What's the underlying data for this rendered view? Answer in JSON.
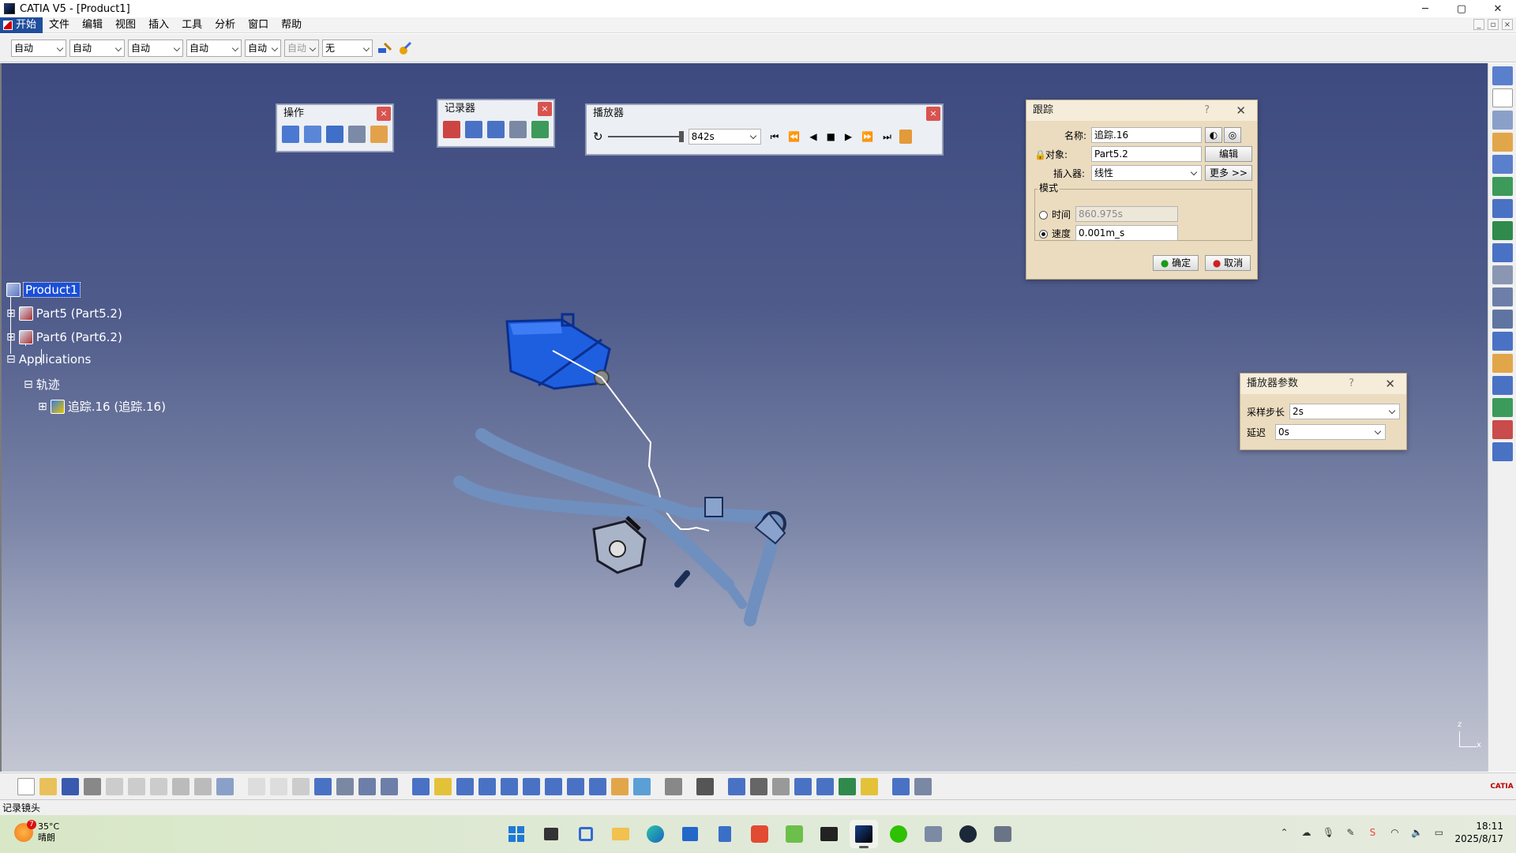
{
  "window": {
    "title": "CATIA V5 - [Product1]",
    "minimize": "─",
    "maximize": "▢",
    "close": "✕"
  },
  "menu": {
    "items": [
      "开始",
      "文件",
      "编辑",
      "视图",
      "插入",
      "工具",
      "分析",
      "窗口",
      "帮助"
    ]
  },
  "toolbar": {
    "combos": [
      "自动",
      "自动",
      "自动",
      "自动",
      "自动",
      "自动",
      "无"
    ]
  },
  "tree": {
    "root": "Product1",
    "part5": "Part5 (Part5.2)",
    "part6": "Part6 (Part6.2)",
    "applications": "Applications",
    "track": "轨迹",
    "trace": "追踪.16 (追踪.16)"
  },
  "panels": {
    "operate": {
      "title": "操作"
    },
    "recorder": {
      "title": "记录器"
    },
    "player": {
      "title": "播放器",
      "time_value": "842s"
    }
  },
  "trace_dialog": {
    "title": "跟踪",
    "help": "?",
    "name_label": "名称:",
    "name_value": "追踪.16",
    "object_label": "对象:",
    "object_value": "Part5.2",
    "edit_button": "编辑",
    "interpolator_label": "插入器:",
    "interpolator_value": "线性",
    "more_button": "更多 >>",
    "mode_label": "模式",
    "time_label": "时间",
    "time_value": "860.975s",
    "speed_label": "速度",
    "speed_value": "0.001m_s",
    "ok_button": "确定",
    "cancel_button": "取消"
  },
  "player_params": {
    "title": "播放器参数",
    "help": "?",
    "step_label": "采样步长",
    "step_value": "2s",
    "delay_label": "延迟",
    "delay_value": "0s"
  },
  "axis": {
    "z": "z",
    "x": "x"
  },
  "status": {
    "text": "记录镜头"
  },
  "taskbar": {
    "weather_temp": "35°C",
    "weather_desc": "晴朗",
    "weather_badge": "7",
    "time": "18:11",
    "date": "2025/8/17"
  },
  "brand": {
    "label": "CATIA"
  }
}
